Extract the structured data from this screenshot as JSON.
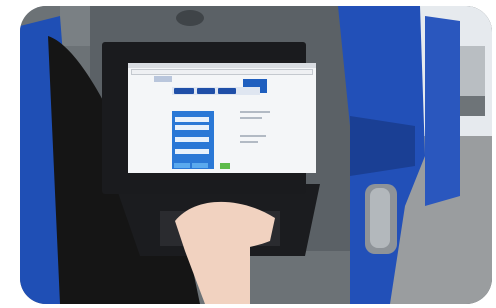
{
  "scene": {
    "subject": "person-using-laptop-on-train",
    "colors": {
      "seat_blue": "#1f4fb5",
      "seat_dark": "#163a8a",
      "laptop_black": "#1b1c1f",
      "wall_grey": "#6f7477",
      "window_light": "#e8ecef",
      "site_blue": "#2a78d6",
      "site_green": "#5dbb4a",
      "skin": "#f1d2c0",
      "sleeve": "#141414"
    }
  }
}
